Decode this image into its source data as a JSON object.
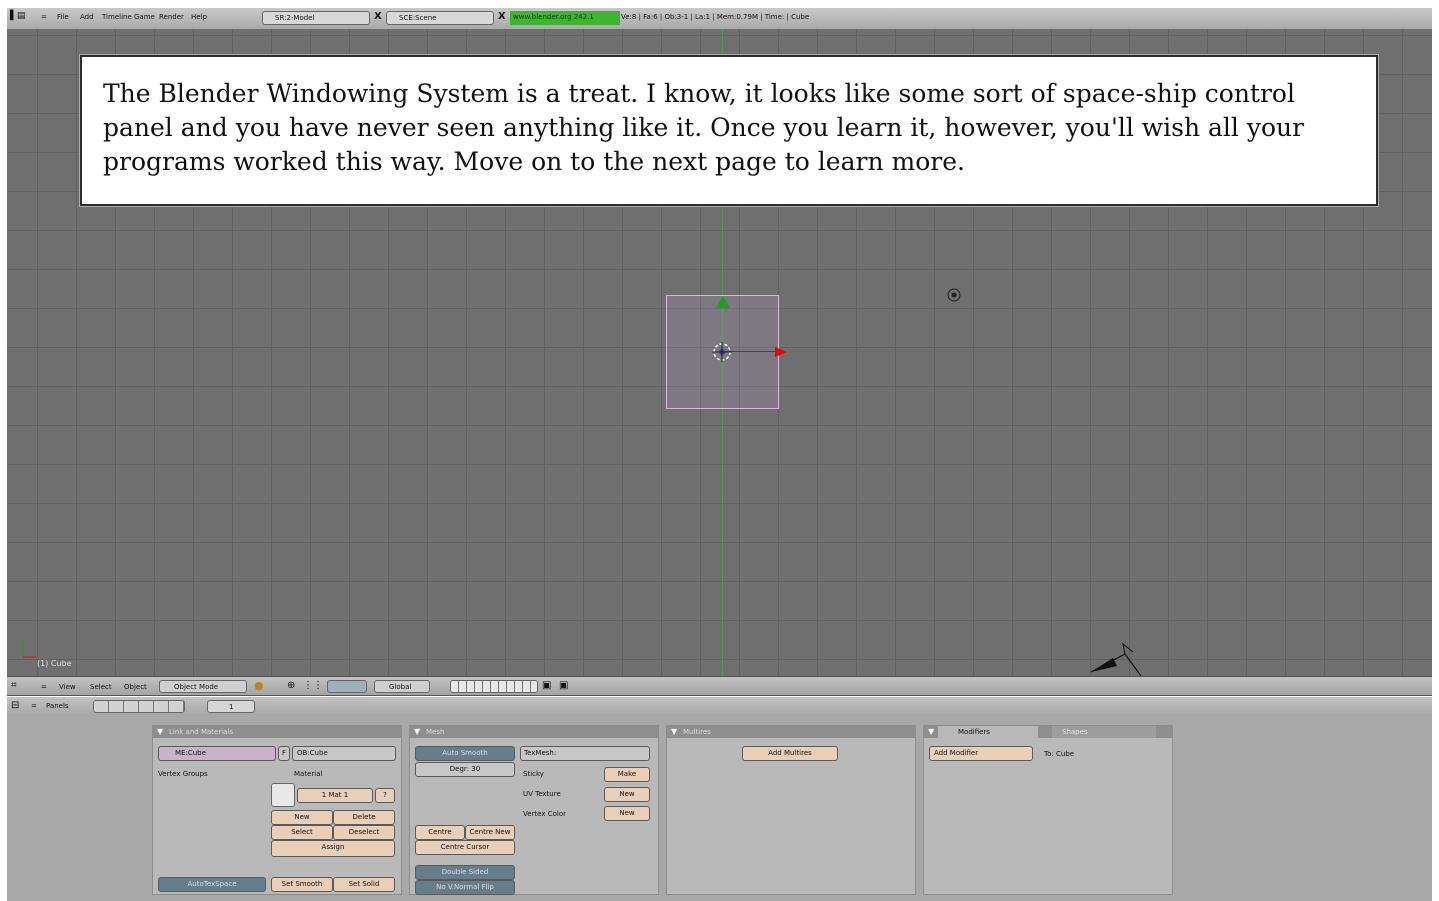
{
  "top_header": {
    "menu": [
      "File",
      "Add",
      "Timeline",
      "Game",
      "Render",
      "Help"
    ],
    "screen": "SR:2-Model",
    "scene": "SCE:Scene",
    "website": "www.blender.org 242.1",
    "stats": "Ve:8 | Fa:6 | Ob:3-1 | La:1  | Mem:0.79M  | Time: | Cube"
  },
  "note": {
    "text": "The Blender Windowing System is a treat. I know, it looks like some sort of space-ship control panel and you have never seen anything like it. Once you learn it, however, you'll wish all your programs worked this way. Move on to the next page to learn more."
  },
  "viewport": {
    "object_label": "(1) Cube"
  },
  "view3d_header": {
    "menu": [
      "View",
      "Select",
      "Object"
    ],
    "mode": "Object Mode",
    "orientation": "Global"
  },
  "buttons_header": {
    "label": "Panels",
    "frame": "1"
  },
  "panels": {
    "link_materials": {
      "title": "Link and Materials",
      "me_field": "ME:Cube",
      "f_label": "F",
      "ob_field": "OB:Cube",
      "vertex_groups": "Vertex Groups",
      "material": "Material",
      "mat_field": "1 Mat 1",
      "mat_q": "?",
      "new": "New",
      "delete": "Delete",
      "select": "Select",
      "deselect": "Deselect",
      "assign": "Assign",
      "autotex": "AutoTexSpace",
      "set_smooth": "Set Smooth",
      "set_solid": "Set Solid"
    },
    "mesh": {
      "title": "Mesh",
      "auto_smooth": "Auto Smooth",
      "degr": "Degr: 30",
      "texmesh": "TexMesh:",
      "sticky": "Sticky",
      "make": "Make",
      "uv_texture": "UV Texture",
      "new1": "New",
      "vertex_color": "Vertex Color",
      "new2": "New",
      "centre": "Centre",
      "centre_new": "Centre New",
      "centre_cursor": "Centre Cursor",
      "double_sided": "Double Sided",
      "no_v_normal_flip": "No V.Normal Flip"
    },
    "multires": {
      "title": "Multires",
      "add": "Add Multires"
    },
    "modifiers": {
      "tab_modifiers": "Modifiers",
      "tab_shapes": "Shapes",
      "add": "Add Modifier",
      "to": "To: Cube"
    }
  }
}
